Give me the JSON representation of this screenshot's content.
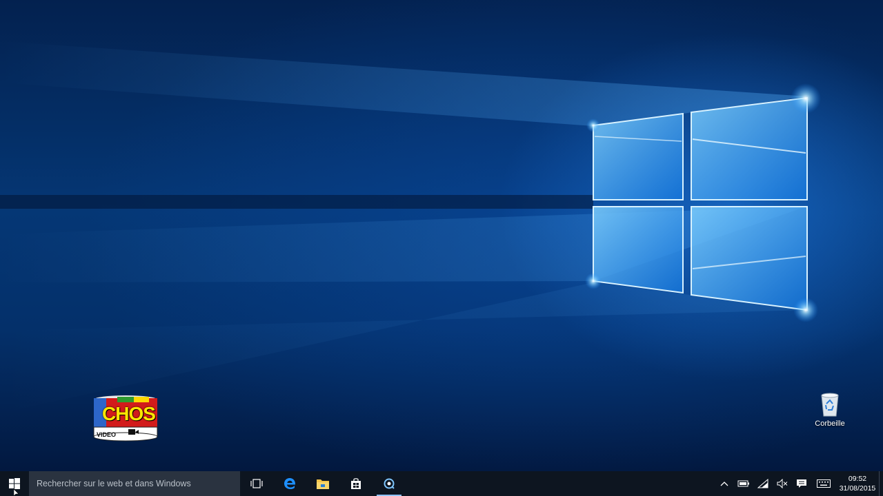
{
  "desktop": {
    "logo_text": "CHOS",
    "logo_subtext": "VIDEO",
    "recycle_bin_label": "Corbeille"
  },
  "taskbar": {
    "search_placeholder": "Rechercher sur le web et dans Windows",
    "pinned": [
      "task-view",
      "edge",
      "file-explorer",
      "store",
      "screen-recorder"
    ],
    "clock": {
      "time": "09:52",
      "date": "31/08/2015"
    }
  },
  "colors": {
    "taskbar_bg": "#0d1520",
    "search_bg": "#2a3340",
    "accent": "#1e90ff",
    "wallpaper_base": "#053775"
  }
}
